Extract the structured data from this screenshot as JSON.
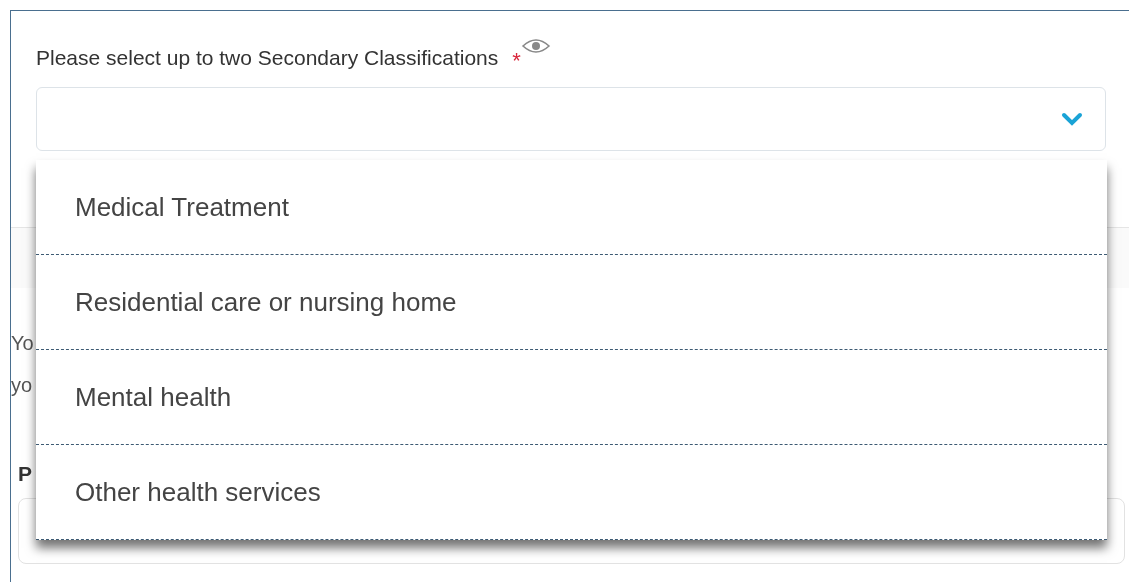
{
  "field": {
    "label": "Please select up to two Secondary Classifications",
    "required_mark": "*",
    "expanded": true
  },
  "options": [
    {
      "label": "Medical Treatment",
      "selected": false
    },
    {
      "label": "Residential care or nursing home",
      "selected": false
    },
    {
      "label": "Mental health",
      "selected": false
    },
    {
      "label": "Other health services",
      "selected": false
    }
  ],
  "background_text": {
    "line_1": "Yo",
    "line_2": "yo",
    "next_label": "P"
  }
}
